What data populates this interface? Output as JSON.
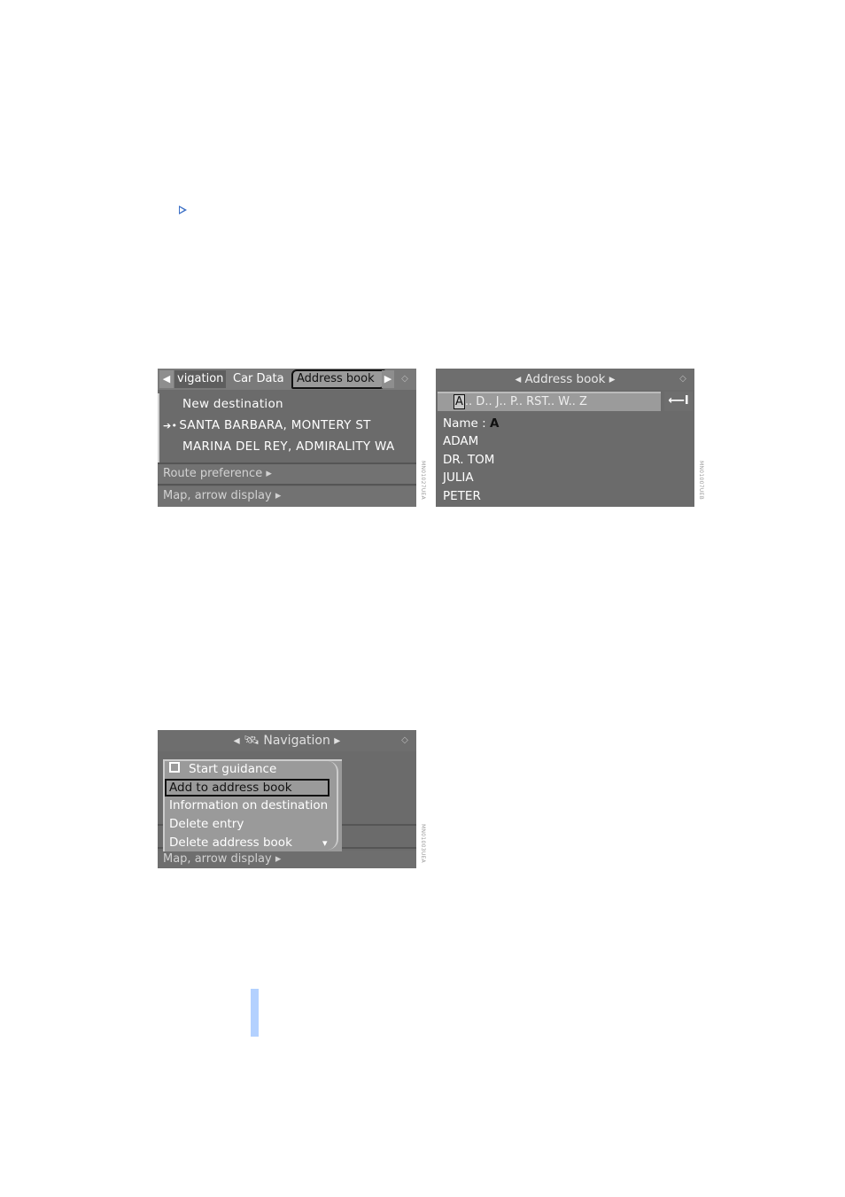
{
  "page": {
    "accent_blue": "#3b6fc6",
    "sidebar_marker_color": "#b3d1ff"
  },
  "screen1": {
    "tabs": {
      "left_arrow": "◀",
      "nav": "vigation",
      "car": "Car Data",
      "address_book": "Address book",
      "right_arrow": "▶"
    },
    "nav_icon": "◇",
    "items": [
      {
        "label": "New destination",
        "marker": ""
      },
      {
        "label": "SANTA BARBARA, MONTERY ST",
        "marker": "➔•"
      },
      {
        "label": "MARINA DEL REY, ADMIRALITY WA",
        "marker": ""
      }
    ],
    "menu": [
      {
        "label": "Route preference ▸"
      },
      {
        "label": "Map, arrow display ▸"
      }
    ],
    "code": "MN01027UEA"
  },
  "screen2": {
    "title": "◂ Address book ▸",
    "speller_cursor": "A",
    "speller_rest": ".. D.. J.. P.. RST.. W.. Z",
    "back_icon": "⟵I",
    "name_label": "Name : ",
    "name_value": "A",
    "entries": [
      "ADAM",
      "DR. TOM",
      "JULIA",
      "PETER"
    ],
    "code": "MN01007UEB"
  },
  "screen3": {
    "title": "◂ 🛰 Navigation ▸",
    "popup_items": [
      {
        "label": "Start guidance",
        "checkbox": true
      },
      {
        "label": "Add to address book",
        "selected": true
      },
      {
        "label": "Information on destination"
      },
      {
        "label": "Delete entry"
      },
      {
        "label": "Delete address book"
      }
    ],
    "scroll_down": "▾",
    "bottom_menu": "Map, arrow display ▸",
    "code": "MN01003UEA"
  }
}
